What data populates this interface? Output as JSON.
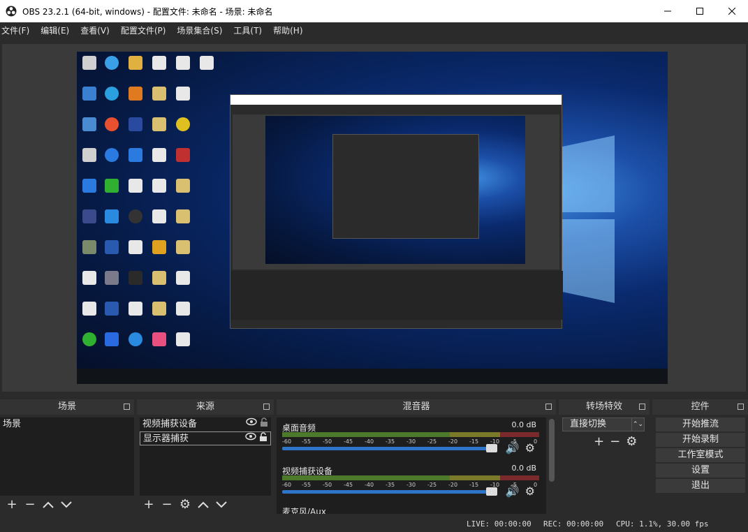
{
  "window": {
    "title": "OBS 23.2.1 (64-bit, windows) - 配置文件: 未命名 - 场景: 未命名"
  },
  "menu": [
    "文件(F)",
    "编辑(E)",
    "查看(V)",
    "配置文件(P)",
    "场景集合(S)",
    "工具(T)",
    "帮助(H)"
  ],
  "docks": {
    "scenes": {
      "title": "场景",
      "items": [
        "场景"
      ]
    },
    "sources": {
      "title": "来源",
      "items": [
        "视频捕获设备",
        "显示器捕获"
      ]
    },
    "mixer": {
      "title": "混音器",
      "channels": [
        {
          "name": "桌面音频",
          "db": "0.0 dB"
        },
        {
          "name": "视频捕获设备",
          "db": "0.0 dB"
        },
        {
          "name": "麦克风/Aux",
          "db": ""
        }
      ],
      "scale": [
        "-60",
        "-55",
        "-50",
        "-45",
        "-40",
        "-35",
        "-30",
        "-25",
        "-20",
        "-15",
        "-10",
        "-5",
        "0"
      ]
    },
    "transitions": {
      "title": "转场特效",
      "selected": "直接切换"
    },
    "controls": {
      "title": "控件",
      "buttons": [
        "开始推流",
        "开始录制",
        "工作室模式",
        "设置",
        "退出"
      ]
    }
  },
  "status": {
    "live": "LIVE: 00:00:00",
    "rec": "REC: 00:00:00",
    "cpu": "CPU: 1.1%, 30.00 fps"
  },
  "icons": {
    "add": "plus-icon",
    "remove": "minus-icon",
    "up": "chevron-up-icon",
    "down": "chevron-down-icon",
    "gear": "gear-icon",
    "eye": "eye-icon",
    "lock": "lock-icon",
    "speaker": "speaker-icon"
  }
}
